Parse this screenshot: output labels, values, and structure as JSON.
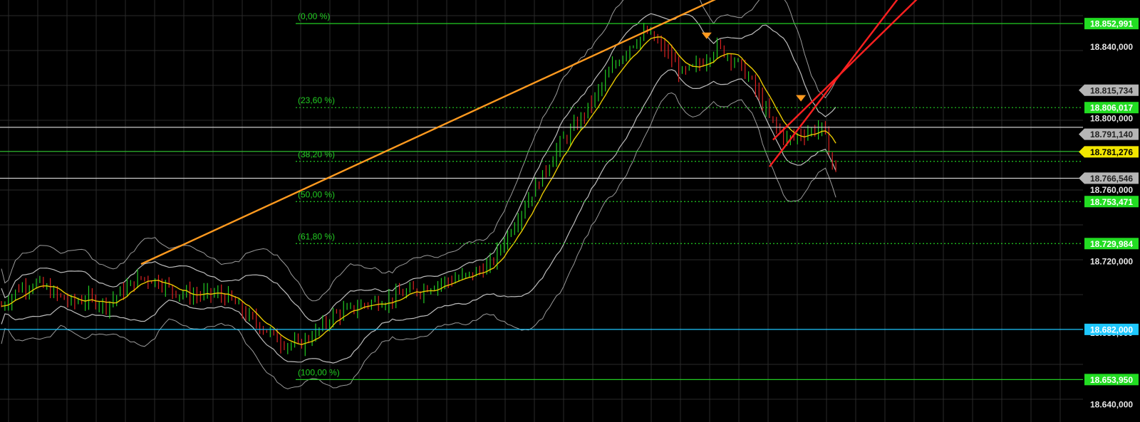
{
  "chart_data": {
    "type": "candlestick",
    "y_axis": {
      "range": [
        18.633,
        18.863
      ],
      "tick_labels": [
        "18.840,000",
        "18.800,000",
        "18.760,000",
        "18.720,000",
        "18.680,000",
        "18.640,000"
      ],
      "tick_values": [
        18.84,
        18.8,
        18.76,
        18.72,
        18.68,
        18.64
      ]
    },
    "fibonacci": [
      {
        "label": "(0,00 %)",
        "price": 18.852991,
        "price_label": "18.852,991",
        "style": "solid"
      },
      {
        "label": "(23,60 %)",
        "price": 18.806017,
        "price_label": "18.806,017",
        "style": "dotted"
      },
      {
        "label": "(38,20 %)",
        "price": 18.775953,
        "price_label": "",
        "style": "dotted"
      },
      {
        "label": "(50,00 %)",
        "price": 18.753471,
        "price_label": "18.753,471",
        "style": "dotted"
      },
      {
        "label": "(61,80 %)",
        "price": 18.729984,
        "price_label": "18.729,984",
        "style": "dotted"
      },
      {
        "label": "(100,00 %)",
        "price": 18.65395,
        "price_label": "18.653,950",
        "style": "solid"
      }
    ],
    "horizontal_lines": [
      {
        "price": 18.682,
        "label": "18.682,000",
        "color": "#1ec8ff",
        "tag_color": "#1ec8ff"
      },
      {
        "price": 18.795,
        "label": "",
        "color": "#cccccc"
      },
      {
        "price": 18.7815,
        "label": "",
        "color": "#33cc33"
      },
      {
        "price": 18.7665,
        "label": "",
        "color": "#cccccc"
      }
    ],
    "price_tags": [
      {
        "label": "18.815,734",
        "price": 18.815734,
        "color": "#b5b5b5"
      },
      {
        "label": "18.791,140",
        "price": 18.79114,
        "color": "#b5b5b5"
      },
      {
        "label": "18.781,276",
        "price": 18.781276,
        "color": "#f2e600"
      },
      {
        "label": "18.766,546",
        "price": 18.766546,
        "color": "#b5b5b5"
      }
    ],
    "trendlines": [
      {
        "color": "#ff9a1f",
        "from": {
          "bar": 40,
          "price": 18.7185
        },
        "to": {
          "bar": 205,
          "price": 18.867
        }
      },
      {
        "color": "#ff2020",
        "from": {
          "bar": 220,
          "price": 18.773
        },
        "to": {
          "bar": 258,
          "price": 18.87
        }
      },
      {
        "color": "#ff2020",
        "from": {
          "bar": 221,
          "price": 18.788
        },
        "to": {
          "bar": 264,
          "price": 18.87
        }
      }
    ],
    "markers": [
      {
        "bar": 202,
        "price": 18.846,
        "color": "#ff9a1f"
      },
      {
        "bar": 229,
        "price": 18.811,
        "color": "#ff9a1f"
      }
    ],
    "series_points": [
      [
        0,
        18.695
      ],
      [
        5,
        18.705
      ],
      [
        10,
        18.708
      ],
      [
        15,
        18.702
      ],
      [
        20,
        18.697
      ],
      [
        25,
        18.699
      ],
      [
        30,
        18.696
      ],
      [
        35,
        18.704
      ],
      [
        40,
        18.711
      ],
      [
        45,
        18.709
      ],
      [
        50,
        18.703
      ],
      [
        55,
        18.701
      ],
      [
        60,
        18.702
      ],
      [
        65,
        18.7
      ],
      [
        70,
        18.69
      ],
      [
        75,
        18.683
      ],
      [
        80,
        18.675
      ],
      [
        85,
        18.673
      ],
      [
        90,
        18.68
      ],
      [
        95,
        18.69
      ],
      [
        100,
        18.693
      ],
      [
        105,
        18.697
      ],
      [
        110,
        18.698
      ],
      [
        115,
        18.702
      ],
      [
        120,
        18.704
      ],
      [
        125,
        18.708
      ],
      [
        130,
        18.71
      ],
      [
        135,
        18.713
      ],
      [
        140,
        18.718
      ],
      [
        145,
        18.735
      ],
      [
        150,
        18.752
      ],
      [
        155,
        18.768
      ],
      [
        160,
        18.786
      ],
      [
        165,
        18.797
      ],
      [
        170,
        18.812
      ],
      [
        175,
        18.828
      ],
      [
        180,
        18.841
      ],
      [
        185,
        18.848
      ],
      [
        190,
        18.838
      ],
      [
        195,
        18.825
      ],
      [
        200,
        18.83
      ],
      [
        205,
        18.84
      ],
      [
        210,
        18.833
      ],
      [
        215,
        18.82
      ],
      [
        220,
        18.8
      ],
      [
        225,
        18.788
      ],
      [
        230,
        18.792
      ],
      [
        235,
        18.795
      ],
      [
        239,
        18.77
      ]
    ]
  }
}
